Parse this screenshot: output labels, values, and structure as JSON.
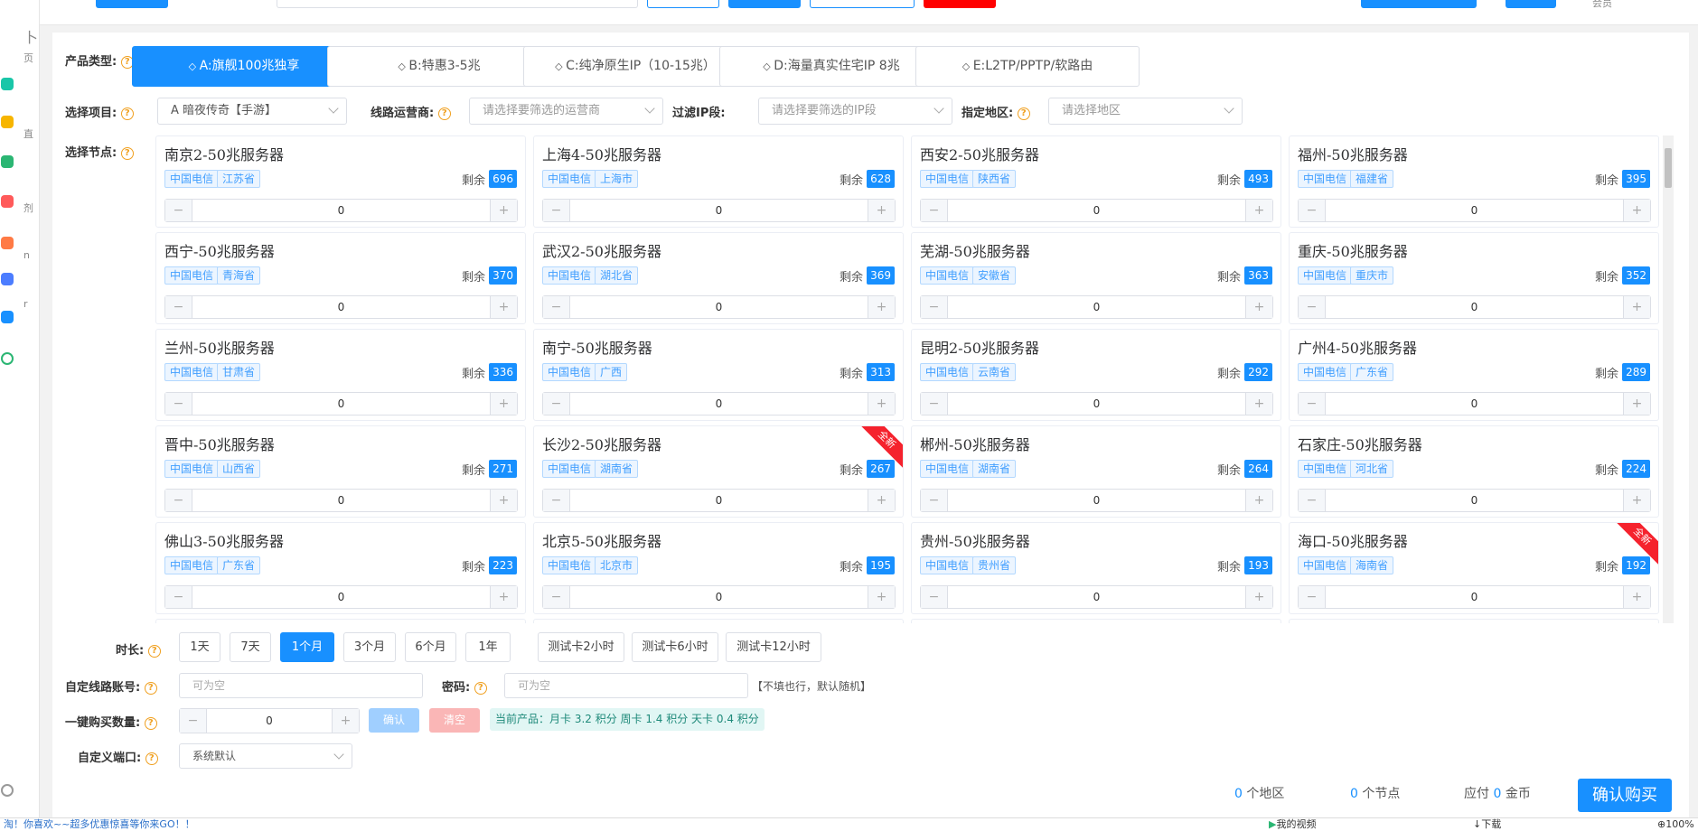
{
  "product_type": {
    "label": "产品类型:",
    "options": [
      {
        "label": "A:旗舰100兆独享",
        "icon": "layers-icon"
      },
      {
        "label": "B:特惠3-5兆",
        "icon": "smile-icon"
      },
      {
        "label": "C:纯净原生IP（10-15兆）",
        "icon": "location-icon"
      },
      {
        "label": "D:海量真实住宅IP 8兆",
        "icon": "user-icon"
      },
      {
        "label": "E:L2TP/PPTP/软路由",
        "icon": "monitor-icon"
      }
    ],
    "active_index": 0
  },
  "filters": {
    "project_label": "选择项目:",
    "project_value": "A 暗夜传奇【手游】",
    "carrier_label": "线路运营商:",
    "carrier_placeholder": "请选择要筛选的运营商",
    "ip_label": "过滤IP段:",
    "ip_placeholder": "请选择要筛选的IP段",
    "region_label": "指定地区:",
    "region_placeholder": "请选择地区"
  },
  "nodes_label": "选择节点:",
  "remaining_label": "剩余",
  "nodes": [
    {
      "name": "南京2-50兆服务器",
      "isp": "中国电信",
      "region": "江苏省",
      "count": "696",
      "qty": "0"
    },
    {
      "name": "上海4-50兆服务器",
      "isp": "中国电信",
      "region": "上海市",
      "count": "628",
      "qty": "0"
    },
    {
      "name": "西安2-50兆服务器",
      "isp": "中国电信",
      "region": "陕西省",
      "count": "493",
      "qty": "0"
    },
    {
      "name": "福州-50兆服务器",
      "isp": "中国电信",
      "region": "福建省",
      "count": "395",
      "qty": "0"
    },
    {
      "name": "西宁-50兆服务器",
      "isp": "中国电信",
      "region": "青海省",
      "count": "370",
      "qty": "0"
    },
    {
      "name": "武汉2-50兆服务器",
      "isp": "中国电信",
      "region": "湖北省",
      "count": "369",
      "qty": "0"
    },
    {
      "name": "芜湖-50兆服务器",
      "isp": "中国电信",
      "region": "安徽省",
      "count": "363",
      "qty": "0"
    },
    {
      "name": "重庆-50兆服务器",
      "isp": "中国电信",
      "region": "重庆市",
      "count": "352",
      "qty": "0"
    },
    {
      "name": "兰州-50兆服务器",
      "isp": "中国电信",
      "region": "甘肃省",
      "count": "336",
      "qty": "0"
    },
    {
      "name": "南宁-50兆服务器",
      "isp": "中国电信",
      "region": "广西",
      "count": "313",
      "qty": "0"
    },
    {
      "name": "昆明2-50兆服务器",
      "isp": "中国电信",
      "region": "云南省",
      "count": "292",
      "qty": "0"
    },
    {
      "name": "广州4-50兆服务器",
      "isp": "中国电信",
      "region": "广东省",
      "count": "289",
      "qty": "0"
    },
    {
      "name": "晋中-50兆服务器",
      "isp": "中国电信",
      "region": "山西省",
      "count": "271",
      "qty": "0"
    },
    {
      "name": "长沙2-50兆服务器",
      "isp": "中国电信",
      "region": "湖南省",
      "count": "267",
      "qty": "0",
      "badge": "全新"
    },
    {
      "name": "郴州-50兆服务器",
      "isp": "中国电信",
      "region": "湖南省",
      "count": "264",
      "qty": "0"
    },
    {
      "name": "石家庄-50兆服务器",
      "isp": "中国电信",
      "region": "河北省",
      "count": "224",
      "qty": "0"
    },
    {
      "name": "佛山3-50兆服务器",
      "isp": "中国电信",
      "region": "广东省",
      "count": "223",
      "qty": "0"
    },
    {
      "name": "北京5-50兆服务器",
      "isp": "中国电信",
      "region": "北京市",
      "count": "195",
      "qty": "0"
    },
    {
      "name": "贵州-50兆服务器",
      "isp": "中国电信",
      "region": "贵州省",
      "count": "193",
      "qty": "0"
    },
    {
      "name": "海口-50兆服务器",
      "isp": "中国电信",
      "region": "海南省",
      "count": "192",
      "qty": "0",
      "badge": "全新"
    }
  ],
  "duration": {
    "label": "时长:",
    "options": [
      "1天",
      "7天",
      "1个月",
      "3个月",
      "6个月",
      "1年"
    ],
    "active_index": 2,
    "test_options": [
      "测试卡2小时",
      "测试卡6小时",
      "测试卡12小时"
    ]
  },
  "account": {
    "label": "自定线路账号:",
    "placeholder": "可为空",
    "password_label": "密码:",
    "password_placeholder": "可为空",
    "hint": "【不填也行，默认随机】"
  },
  "bulk": {
    "label": "一键购买数量:",
    "value": "0",
    "confirm": "确认",
    "clear": "清空",
    "price_info": "当前产品：月卡 3.2 积分 周卡 1.4 积分 天卡 0.4 积分"
  },
  "port": {
    "label": "自定义端口:",
    "value": "系统默认"
  },
  "summary": {
    "regions_count": "0",
    "regions_label": "个地区",
    "nodes_count": "0",
    "nodes_label": "个节点",
    "pay_label": "应付",
    "pay_value": "0",
    "pay_unit": "金币",
    "buy_button": "确认购买"
  },
  "topbar": {
    "right_text": "会员"
  },
  "statusbar": {
    "marquee": "淘！你喜欢~~超多优惠惊喜等你来GO！！",
    "video": "我的视频",
    "download": "下载",
    "zoom": "100%"
  },
  "sidebar_chars": [
    "卜",
    "页",
    "直",
    "剂",
    "n",
    "r"
  ],
  "colors": {
    "primary": "#1890ff",
    "badge": "#f5222d",
    "confirm_disabled": "#a0cfff",
    "clear_disabled": "#fab6b6"
  }
}
